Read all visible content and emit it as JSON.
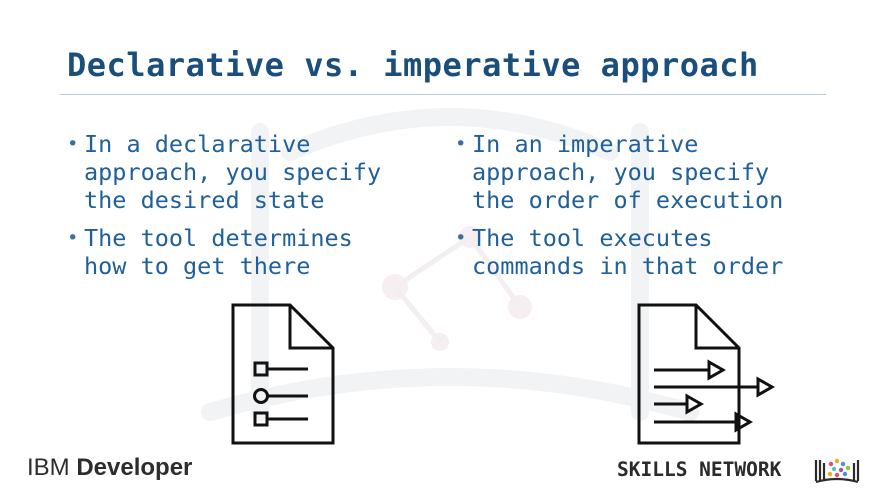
{
  "slide": {
    "title": "Declarative vs. imperative approach"
  },
  "left_column": {
    "bullets": [
      {
        "lines": [
          "In a declarative",
          "approach, you specify",
          "the desired state"
        ]
      },
      {
        "lines": [
          "The tool determines",
          "how to get there"
        ]
      }
    ]
  },
  "right_column": {
    "bullets": [
      {
        "lines": [
          "In an imperative",
          "approach, you specify",
          "the order of execution"
        ]
      },
      {
        "lines": [
          "The tool executes",
          "commands in that order"
        ]
      }
    ]
  },
  "icons": {
    "left": "declarative-document-checklist-icon",
    "right": "imperative-document-arrows-icon"
  },
  "footer": {
    "ibm_brand": "IBM",
    "ibm_product": "Developer",
    "skills_network": "SKILLS NETWORK"
  }
}
